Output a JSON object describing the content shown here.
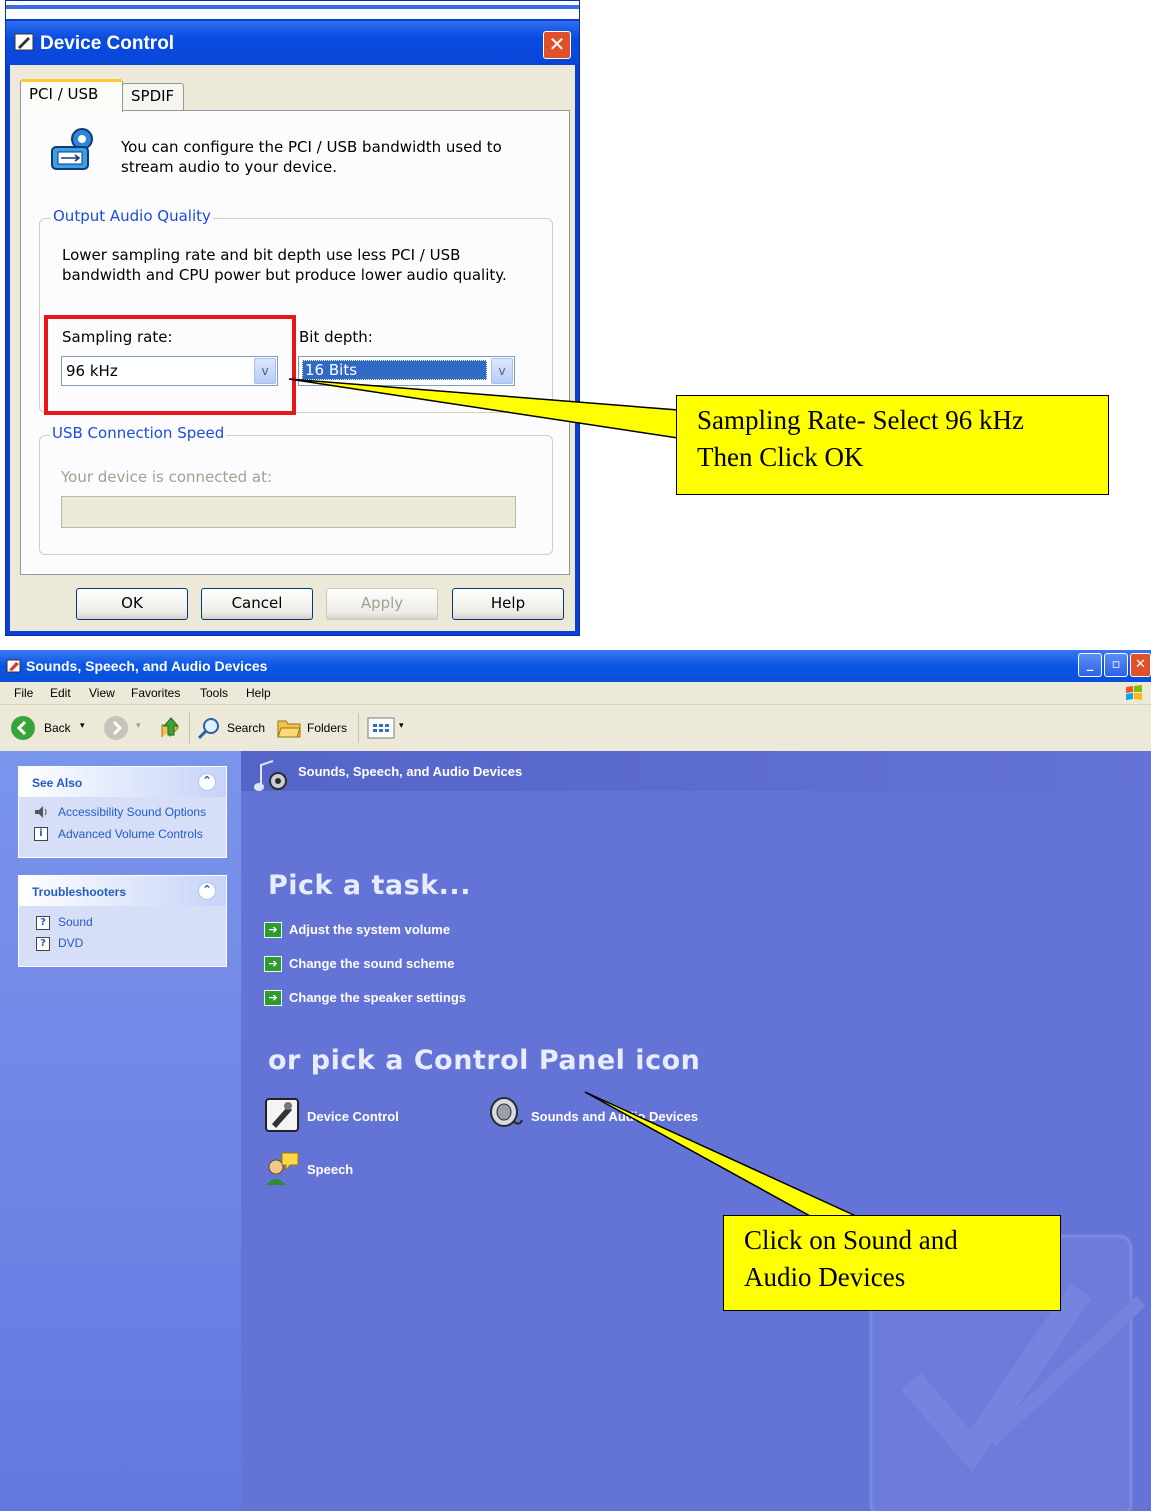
{
  "dialog": {
    "title": "Device Control",
    "close_glyph": "✕",
    "tabs": [
      "PCI / USB",
      "SPDIF"
    ],
    "intro_line1": "You can configure the PCI / USB bandwidth used to",
    "intro_line2": "stream audio to your device.",
    "output_group_label": "Output Audio Quality",
    "output_desc_line1": "Lower sampling rate and bit depth use less PCI / USB",
    "output_desc_line2": "bandwidth and CPU power but produce lower audio quality.",
    "sampling_label": "Sampling rate:",
    "sampling_value": "96 kHz",
    "bitdepth_label": "Bit depth:",
    "bitdepth_value": "16 Bits",
    "usb_group_label": "USB Connection Speed",
    "usb_desc": "Your device is connected at:",
    "usb_value": "",
    "buttons": {
      "ok": "OK",
      "cancel": "Cancel",
      "apply": "Apply",
      "help": "Help"
    },
    "dropdown_glyph": "v"
  },
  "callouts": {
    "sampling_line1": "Sampling Rate- Select 96 kHz",
    "sampling_line2": "Then Click OK",
    "sounds_line1": "Click on Sound and",
    "sounds_line2": "Audio Devices",
    "highlight_color": "#e8161b",
    "fill_color": "#ffff00"
  },
  "window": {
    "title": "Sounds, Speech, and Audio Devices",
    "caption_buttons": [
      "_",
      "▫",
      "✕"
    ],
    "menu": [
      "File",
      "Edit",
      "View",
      "Favorites",
      "Tools",
      "Help"
    ],
    "toolbar": {
      "back": "Back",
      "search": "Search",
      "folders": "Folders"
    },
    "sidebar": {
      "see_also": {
        "title": "See Also",
        "items": [
          "Accessibility Sound Options",
          "Advanced Volume Controls"
        ]
      },
      "troubleshooters": {
        "title": "Troubleshooters",
        "items": [
          "Sound",
          "DVD"
        ]
      },
      "collapse_glyph": "⌃"
    },
    "content": {
      "header": "Sounds, Speech, and Audio Devices",
      "pick_task": "Pick a task...",
      "tasks": [
        "Adjust the system volume",
        "Change the sound scheme",
        "Change the speaker settings"
      ],
      "pick_icon": "or pick a Control Panel icon",
      "icons": [
        "Device Control",
        "Sounds and Audio Devices",
        "Speech"
      ]
    },
    "colors": {
      "title_blue": "#0b56e6",
      "content_bg": "#6473d6",
      "link_blue": "#215dc6"
    }
  }
}
